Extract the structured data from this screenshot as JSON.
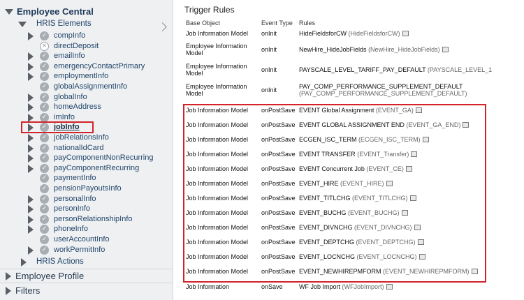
{
  "tree": {
    "root": "Employee Central",
    "hris_elements": "HRIS Elements",
    "items": [
      {
        "label": "compInfo",
        "expand": true,
        "icon": "check"
      },
      {
        "label": "directDeposit",
        "expand": false,
        "icon": "x"
      },
      {
        "label": "emailInfo",
        "expand": true,
        "icon": "check"
      },
      {
        "label": "emergencyContactPrimary",
        "expand": true,
        "icon": "check"
      },
      {
        "label": "employmentInfo",
        "expand": true,
        "icon": "check"
      },
      {
        "label": "globalAssignmentInfo",
        "expand": false,
        "icon": "check"
      },
      {
        "label": "globalInfo",
        "expand": true,
        "icon": "check"
      },
      {
        "label": "homeAddress",
        "expand": true,
        "icon": "check"
      },
      {
        "label": "imInfo",
        "expand": true,
        "icon": "check"
      },
      {
        "label": "jobInfo",
        "expand": true,
        "icon": "check",
        "selected": true
      },
      {
        "label": "jobRelationsInfo",
        "expand": true,
        "icon": "check"
      },
      {
        "label": "nationalIdCard",
        "expand": true,
        "icon": "check"
      },
      {
        "label": "payComponentNonRecurring",
        "expand": true,
        "icon": "check"
      },
      {
        "label": "payComponentRecurring",
        "expand": true,
        "icon": "check"
      },
      {
        "label": "paymentInfo",
        "expand": false,
        "icon": "check"
      },
      {
        "label": "pensionPayoutsInfo",
        "expand": false,
        "icon": "check"
      },
      {
        "label": "personalInfo",
        "expand": true,
        "icon": "check"
      },
      {
        "label": "personInfo",
        "expand": true,
        "icon": "check"
      },
      {
        "label": "personRelationshipInfo",
        "expand": true,
        "icon": "check"
      },
      {
        "label": "phoneInfo",
        "expand": true,
        "icon": "check"
      },
      {
        "label": "userAccountInfo",
        "expand": false,
        "icon": "check"
      },
      {
        "label": "workPermitInfo",
        "expand": true,
        "icon": "check"
      }
    ],
    "hris_actions": "HRIS Actions",
    "employee_profile": "Employee Profile",
    "filters": "Filters"
  },
  "panel": {
    "title": "Trigger Rules",
    "headers": {
      "base_object": "Base Object",
      "event_type": "Event Type",
      "rules": "Rules"
    },
    "rows": [
      {
        "base": "Job Information Model",
        "event": "onInit",
        "rule": "HideFieldsforCW",
        "id": "(HideFieldsforCW)",
        "icon": true
      },
      {
        "base": "Employee Information Model",
        "event": "onInit",
        "rule": "NewHire_HideJobFields",
        "id": "(NewHire_HideJobFields)",
        "icon": true
      },
      {
        "base": "Employee Information Model",
        "event": "onInit",
        "rule": "PAYSCALE_LEVEL_TARIFF_PAY_DEFAULT",
        "id": "(PAYSCALE_LEVEL_1",
        "icon": false
      },
      {
        "base": "Employee Information Model",
        "event": "onInit",
        "rule": "PAY_COMP_PERFORMANCE_SUPPLEMENT_DEFAULT",
        "id": "(PAY_COMP_PERFORMANCE_SUPPLEMENT_DEFAULT)",
        "icon": false
      },
      {
        "base": "Job Information Model",
        "event": "onPostSave",
        "rule": "EVENT Global Assignment",
        "id": "(EVENT_GA)",
        "icon": true
      },
      {
        "base": "Job Information Model",
        "event": "onPostSave",
        "rule": "EVENT GLOBAL ASSIGNMENT END",
        "id": "(EVENT_GA_END)",
        "icon": true
      },
      {
        "base": "Job Information Model",
        "event": "onPostSave",
        "rule": "ECGEN_ISC_TERM",
        "id": "(ECGEN_ISC_TERM)",
        "icon": true
      },
      {
        "base": "Job Information Model",
        "event": "onPostSave",
        "rule": "EVENT TRANSFER",
        "id": "(EVENT_Transfer)",
        "icon": true
      },
      {
        "base": "Job Information Model",
        "event": "onPostSave",
        "rule": "EVENT Concurrent Job",
        "id": "(EVENT_CE)",
        "icon": true
      },
      {
        "base": "Job Information Model",
        "event": "onPostSave",
        "rule": "EVENT_HIRE",
        "id": "(EVENT_HIRE)",
        "icon": true
      },
      {
        "base": "Job Information Model",
        "event": "onPostSave",
        "rule": "EVENT_TITLCHG",
        "id": "(EVENT_TITLCHG)",
        "icon": true
      },
      {
        "base": "Job Information Model",
        "event": "onPostSave",
        "rule": "EVENT_BUCHG",
        "id": "(EVENT_BUCHG)",
        "icon": true
      },
      {
        "base": "Job Information Model",
        "event": "onPostSave",
        "rule": "EVENT_DIVNCHG",
        "id": "(EVENT_DIVNCHG)",
        "icon": true
      },
      {
        "base": "Job Information Model",
        "event": "onPostSave",
        "rule": "EVENT_DEPTCHG",
        "id": "(EVENT_DEPTCHG)",
        "icon": true
      },
      {
        "base": "Job Information Model",
        "event": "onPostSave",
        "rule": "EVENT_LOCNCHG",
        "id": "(EVENT_LOCNCHG)",
        "icon": true
      },
      {
        "base": "Job Information Model",
        "event": "onPostSave",
        "rule": "EVENT_NEWHIREPMFORM",
        "id": "(EVENT_NEWHIREPMFORM)",
        "icon": true
      },
      {
        "base": "Job Information",
        "event": "onSave",
        "rule": "WF Job Import",
        "id": "(WFJobImport)",
        "icon": true
      }
    ]
  }
}
